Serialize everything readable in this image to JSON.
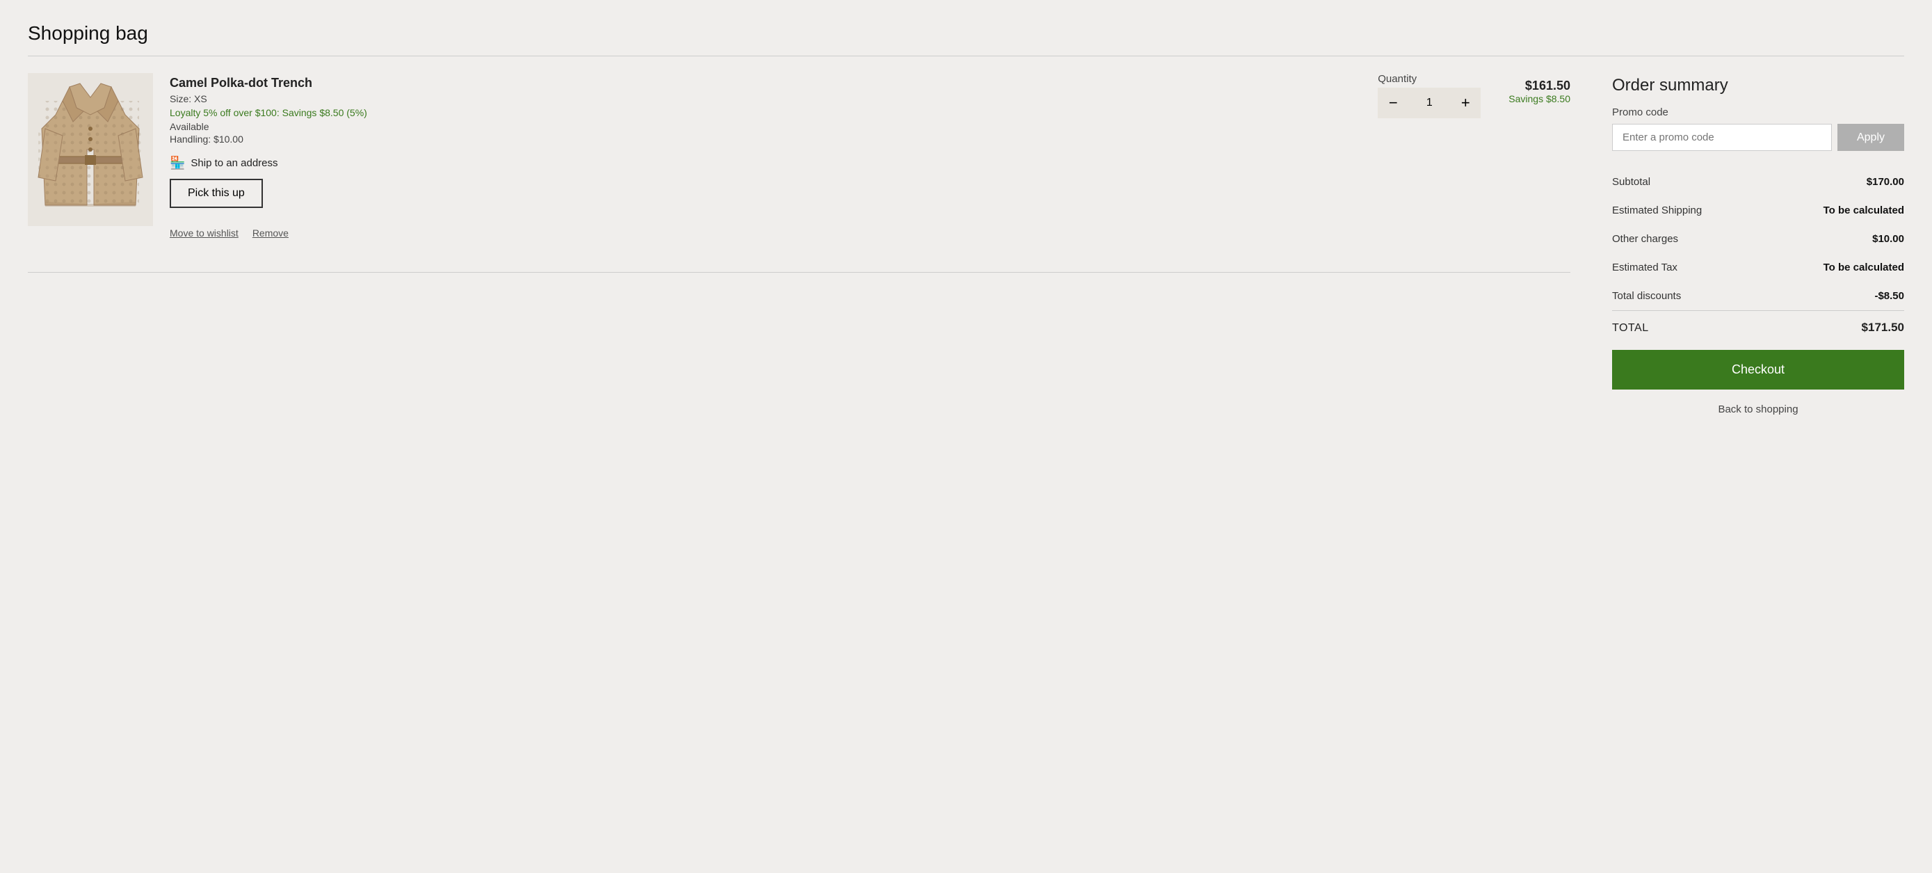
{
  "page": {
    "title": "Shopping bag"
  },
  "cart": {
    "item": {
      "name": "Camel Polka-dot Trench",
      "size_label": "Size: XS",
      "loyalty_text": "Loyalty 5% off over $100: Savings $8.50 (5%)",
      "availability": "Available",
      "handling": "Handling: $10.00",
      "ship_to_address_text": "Ship to an address",
      "pick_up_btn_label": "Pick this up",
      "quantity_label": "Quantity",
      "quantity_value": "1",
      "price": "$161.50",
      "savings": "Savings $8.50",
      "move_to_wishlist_label": "Move to wishlist",
      "remove_label": "Remove"
    }
  },
  "order_summary": {
    "title": "Order summary",
    "promo_label": "Promo code",
    "promo_placeholder": "Enter a promo code",
    "apply_btn_label": "Apply",
    "rows": [
      {
        "label": "Subtotal",
        "value": "$170.00",
        "bold": true
      },
      {
        "label": "Estimated Shipping",
        "value": "To be calculated",
        "bold": true
      },
      {
        "label": "Other charges",
        "value": "$10.00",
        "bold": true
      },
      {
        "label": "Estimated Tax",
        "value": "To be calculated",
        "bold": true
      },
      {
        "label": "Total discounts",
        "value": "-$8.50",
        "bold": true
      }
    ],
    "total_label": "TOTAL",
    "total_value": "$171.50",
    "checkout_label": "Checkout",
    "back_to_shopping_label": "Back to shopping"
  }
}
